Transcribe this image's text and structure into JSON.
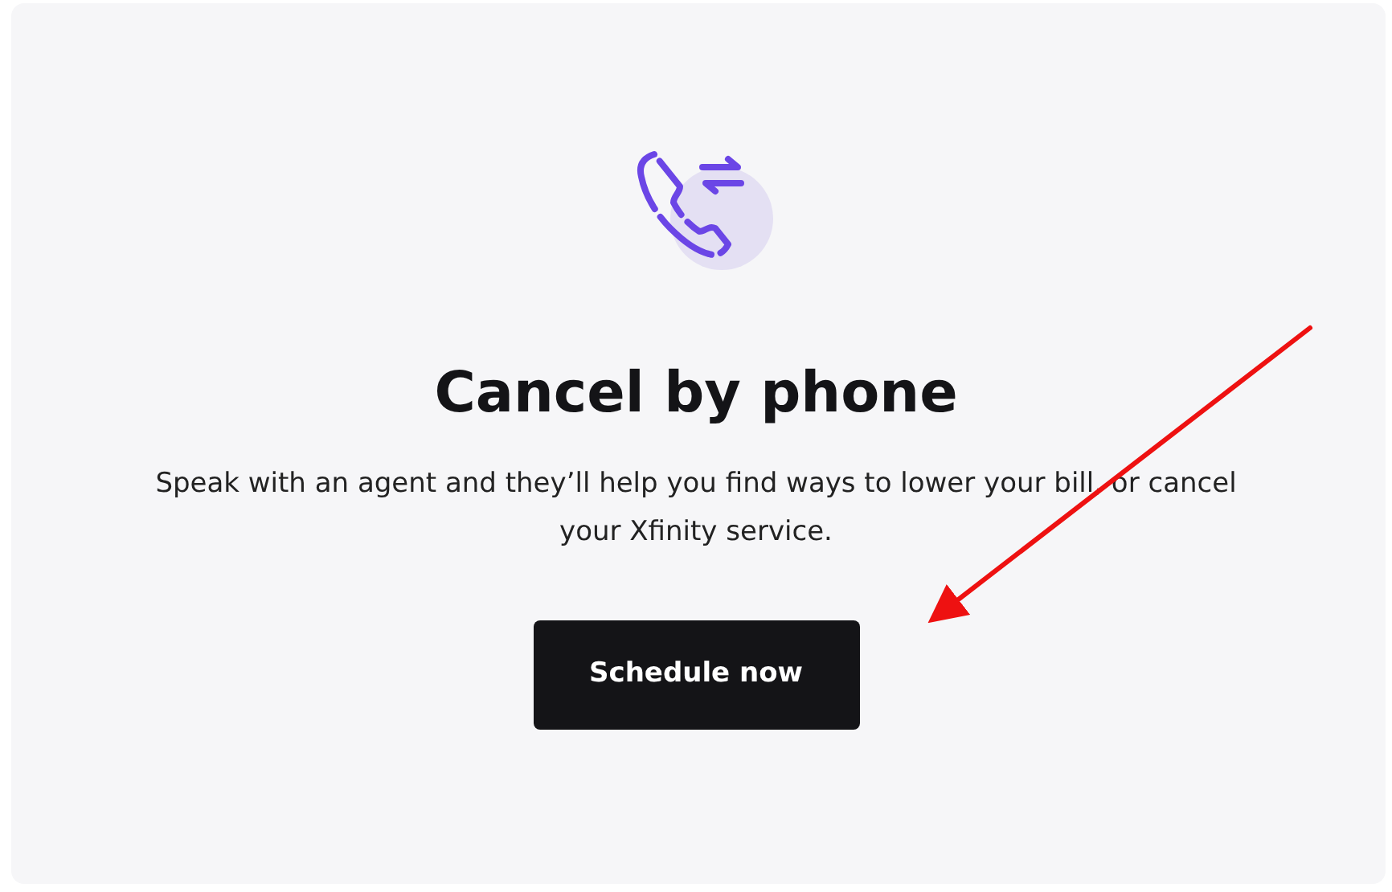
{
  "card": {
    "title": "Cancel by phone",
    "description": "Speak with an agent and they’ll help you find ways to lower your bill, or cancel your Xfinity service.",
    "button": "Schedule now"
  },
  "annotation": {
    "kind": "arrow"
  }
}
